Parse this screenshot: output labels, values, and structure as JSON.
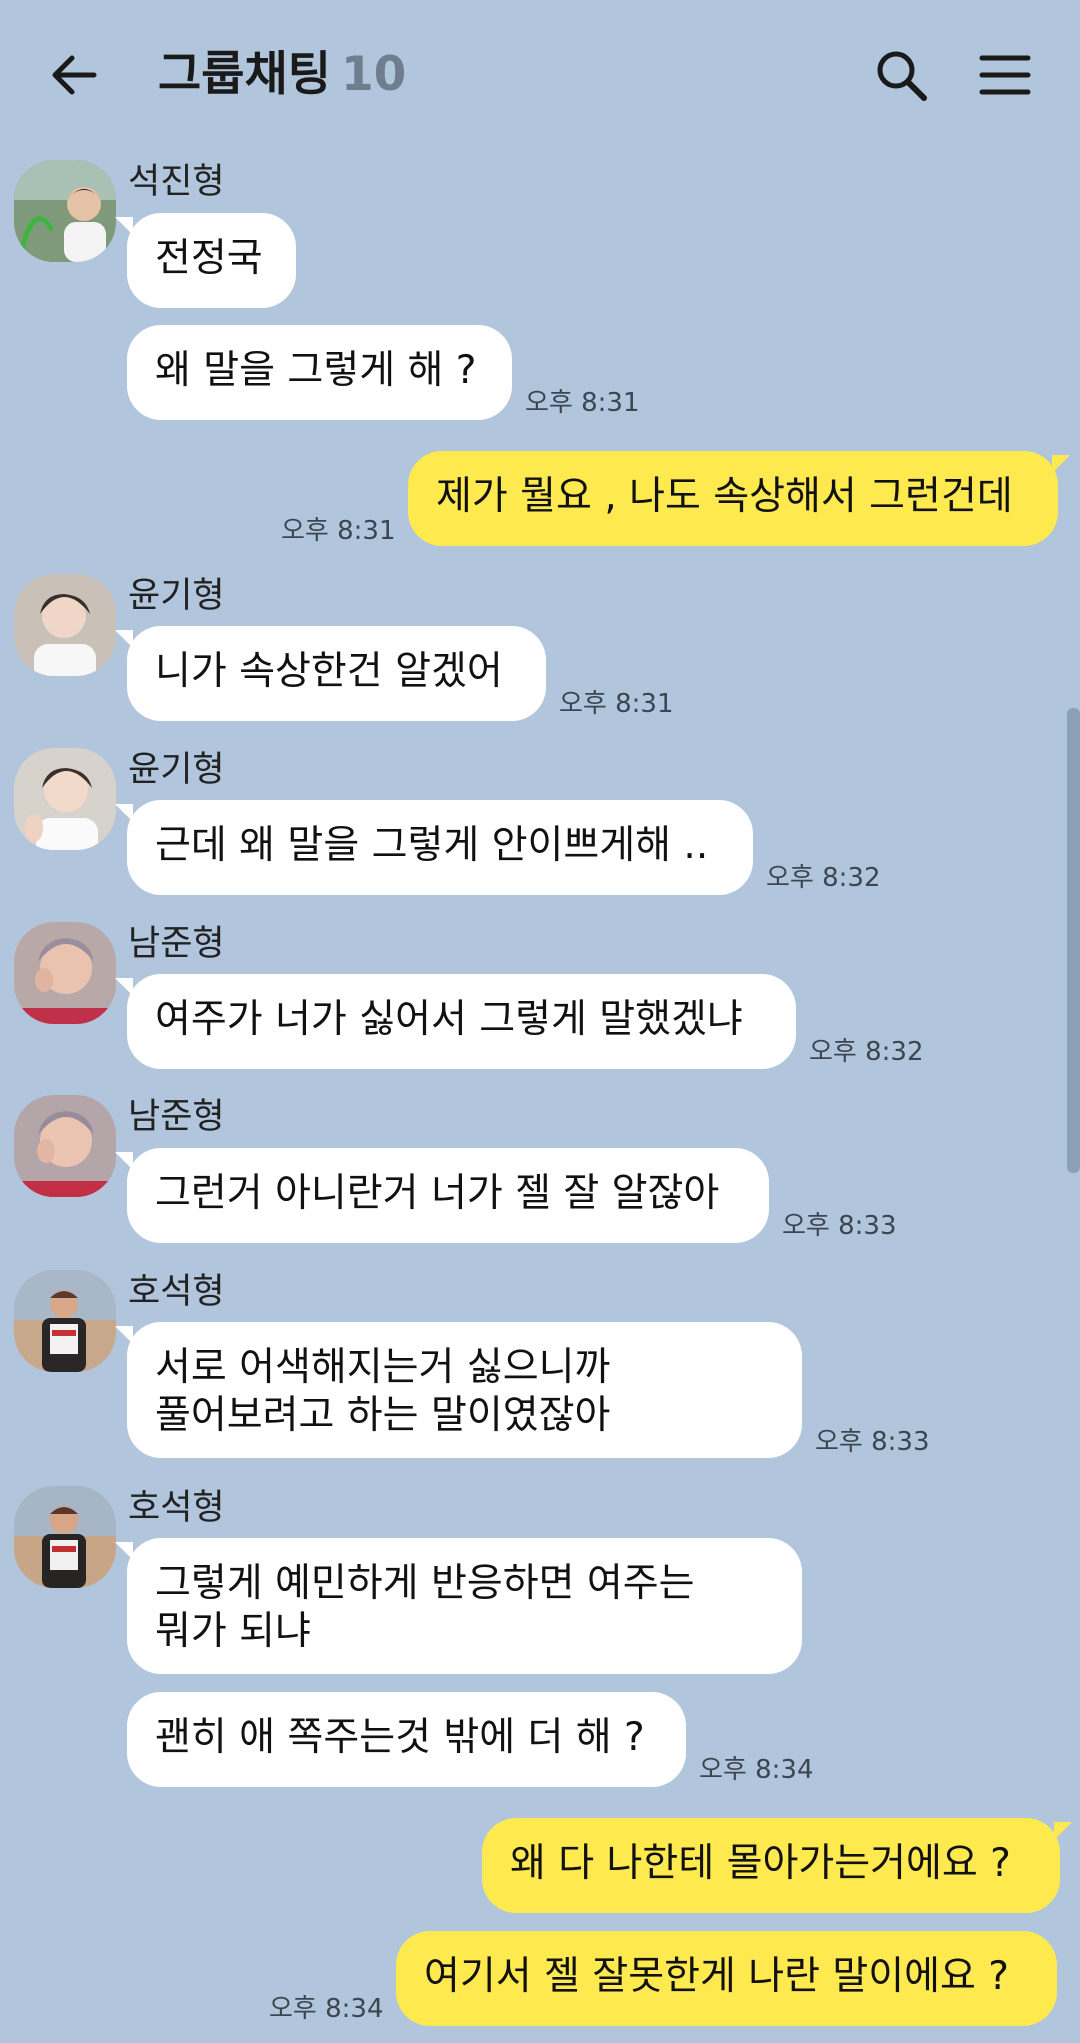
{
  "header": {
    "title": "그룹채팅",
    "member_count": "10"
  },
  "messages": {
    "m1": {
      "sender": "석진형",
      "bubbles": [
        "전정국",
        "왜 말을 그렇게 해 ?"
      ],
      "time": "오후 8:31"
    },
    "m2": {
      "text": "제가 뭘요 , 나도 속상해서 그런건데",
      "time": "오후 8:31"
    },
    "m3": {
      "sender": "윤기형",
      "text": "니가 속상한건 알겠어",
      "time": "오후 8:31"
    },
    "m4": {
      "sender": "윤기형",
      "text": "근데 왜 말을 그렇게 안이쁘게해 ..",
      "time": "오후 8:32"
    },
    "m5": {
      "sender": "남준형",
      "text": "여주가 너가 싫어서 그렇게 말했겠냐",
      "time": "오후 8:32"
    },
    "m6": {
      "sender": "남준형",
      "text": "그런거 아니란거 너가 젤 잘 알잖아",
      "time": "오후 8:33"
    },
    "m7": {
      "sender": "호석형",
      "line1": "서로 어색해지는거 싫으니까",
      "line2": "풀어보려고 하는 말이였잖아",
      "time": "오후 8:33"
    },
    "m8": {
      "sender": "호석형",
      "line1": "그렇게 예민하게 반응하면 여주는",
      "line2": "뭐가 되냐",
      "text2": "괜히 애 쪽주는것 밖에 더 해 ?",
      "time": "오후 8:34"
    },
    "m9": {
      "text1": "왜 다 나한테 몰아가는거에요 ?",
      "text2": "여기서 젤 잘못한게 나란 말이에요 ?",
      "time": "오후 8:34"
    }
  },
  "colors": {
    "background": "#b1c6dc",
    "my_bubble": "#fee94f",
    "other_bubble": "#ffffff"
  },
  "icons": [
    "back-arrow-icon",
    "search-icon",
    "menu-icon"
  ]
}
